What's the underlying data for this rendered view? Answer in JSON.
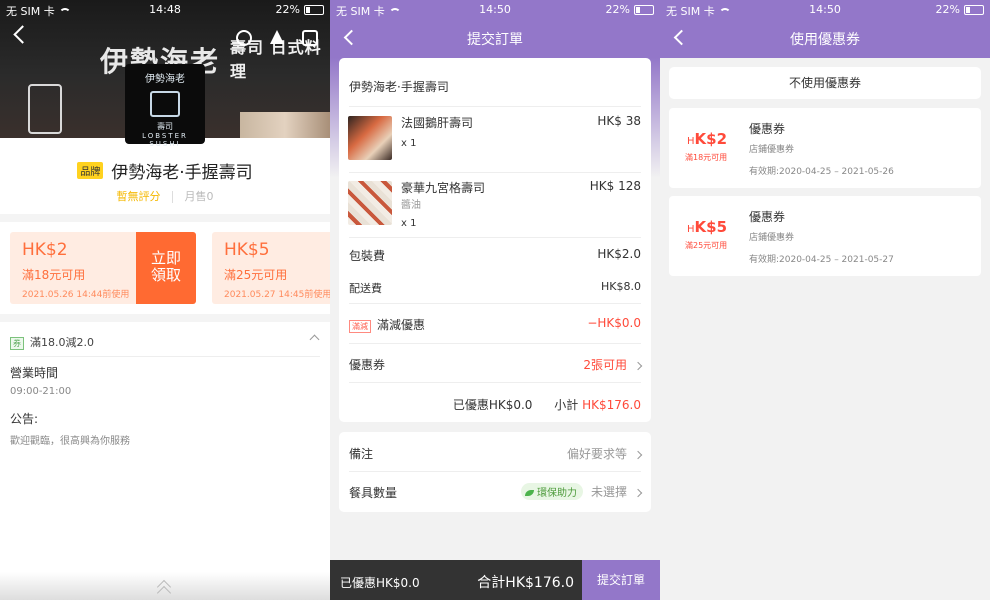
{
  "status": [
    {
      "carrier": "无 SIM 卡",
      "time": "14:48",
      "battery": "22%"
    },
    {
      "carrier": "无 SIM 卡",
      "time": "14:50",
      "battery": "22%"
    },
    {
      "carrier": "无 SIM 卡",
      "time": "14:50",
      "battery": "22%"
    }
  ],
  "store": {
    "sign_text": "伊勢海老",
    "sign_text2": "壽司 日式料理",
    "logo_top": "伊勢海老",
    "logo_mid": "壽司",
    "logo_bottom": "LOBSTER SUSHI",
    "brand_badge": "品牌",
    "name": "伊勢海老·手握壽司",
    "rating": "暫無評分",
    "monthly_sales": "月售0",
    "coupons": [
      {
        "amount": "HK$2",
        "condition": "滿18元可用",
        "expiry": "2021.05.26 14:44前使用",
        "claim": "立即領取"
      },
      {
        "amount": "HK$5",
        "condition": "滿25元可用",
        "expiry": "2021.05.27 14:45前使用"
      }
    ],
    "promo_tag": "券",
    "promo_text": "滿18.0減2.0",
    "hours_title": "營業時間",
    "hours_value": "09:00-21:00",
    "notice_title": "公告:",
    "notice_value": "歡迎觀臨，很高興為你服務"
  },
  "order": {
    "title": "提交訂單",
    "store_name": "伊勢海老·手握壽司",
    "items": [
      {
        "name": "法國鵝肝壽司",
        "price": "HK$ 38",
        "option": "",
        "qty": "x 1"
      },
      {
        "name": "豪華九宮格壽司",
        "price": "HK$ 128",
        "option": "醬油",
        "qty": "x 1"
      }
    ],
    "packaging_label": "包裝費",
    "packaging_value": "HK$2.0",
    "delivery_label": "配送費",
    "delivery_value": "HK$8.0",
    "discount_tag": "滿減",
    "discount_label": "滿減優惠",
    "discount_value": "−HK$0.0",
    "coupon_label": "優惠券",
    "coupon_value": "2張可用",
    "summary_discount": "已優惠HK$0.0",
    "subtotal_label": "小計",
    "subtotal_value": "HK$176.0",
    "remark_label": "備注",
    "remark_value": "偏好要求等",
    "utensils_label": "餐具數量",
    "eco_label": "環保助力",
    "utensils_value": "未選擇",
    "bottom_discount": "已優惠HK$0.0",
    "bottom_total": "合計HK$176.0",
    "submit": "提交訂單"
  },
  "coupon_page": {
    "title": "使用優惠券",
    "no_coupon": "不使用優惠券",
    "coupons": [
      {
        "currency": "H",
        "amount": "K$2",
        "condition": "滿18元可用",
        "title": "優惠券",
        "type": "店鋪優惠券",
        "validity": "有效期:2020-04-25 – 2021-05-26"
      },
      {
        "currency": "H",
        "amount": "K$5",
        "condition": "滿25元可用",
        "title": "優惠券",
        "type": "店鋪優惠券",
        "validity": "有效期:2020-04-25 – 2021-05-27"
      }
    ]
  },
  "colors": {
    "purple": "#9377c9",
    "orange": "#ff6a32",
    "red": "#ff4a3a"
  }
}
